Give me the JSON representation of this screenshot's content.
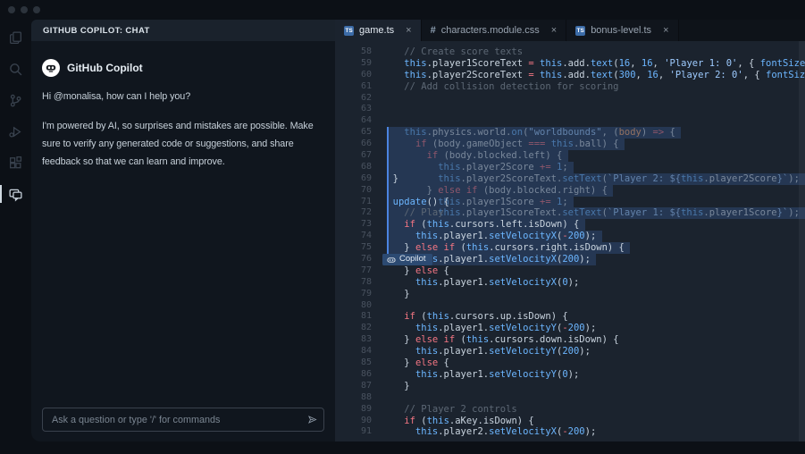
{
  "window": {
    "controls": [
      "close",
      "minimize",
      "maximize"
    ]
  },
  "activity_bar": {
    "items": [
      {
        "name": "explorer"
      },
      {
        "name": "search"
      },
      {
        "name": "source-control"
      },
      {
        "name": "run-and-debug"
      },
      {
        "name": "extensions"
      },
      {
        "name": "copilot-chat",
        "active": true
      }
    ]
  },
  "chat_panel": {
    "header": "GITHUB COPILOT: CHAT",
    "bot_name": "GitHub Copilot",
    "greeting": "Hi @monalisa, how can I help you?",
    "disclaimer": "I'm powered by AI, so surprises and mistakes are possible. Make sure to verify any generated code or suggestions, and share feedback so that we can learn and improve.",
    "input_placeholder": "Ask a question or type '/' for commands",
    "send_icon": "paper-plane"
  },
  "editor": {
    "tabs": [
      {
        "label": "game.ts",
        "icon": "TS",
        "close": "×",
        "active": true
      },
      {
        "label": "characters.module.css",
        "icon": "#",
        "close": "×",
        "active": false
      },
      {
        "label": "bonus-level.ts",
        "icon": "TS",
        "close": "×",
        "active": false
      }
    ],
    "chip_label": "Copilot",
    "lines": [
      {
        "n": 58,
        "t": [
          [
            "c",
            "    // Create score texts"
          ]
        ]
      },
      {
        "n": 59,
        "t": [
          [
            "w",
            "    "
          ],
          [
            "b",
            "this"
          ],
          [
            "w",
            ".player1ScoreText "
          ],
          [
            "k",
            "="
          ],
          [
            "w",
            " "
          ],
          [
            "b",
            "this"
          ],
          [
            "w",
            ".add."
          ],
          [
            "b",
            "text"
          ],
          [
            "w",
            "("
          ],
          [
            "b",
            "16"
          ],
          [
            "w",
            ", "
          ],
          [
            "b",
            "16"
          ],
          [
            "w",
            ", "
          ],
          [
            "s",
            "'Player 1: 0'"
          ],
          [
            "w",
            ", { "
          ],
          [
            "b",
            "fontSize"
          ],
          [
            "w",
            ": "
          ],
          [
            "s",
            "'32px'"
          ],
          [
            "w",
            " });"
          ]
        ]
      },
      {
        "n": 60,
        "t": [
          [
            "w",
            "    "
          ],
          [
            "b",
            "this"
          ],
          [
            "w",
            ".player2ScoreText "
          ],
          [
            "k",
            "="
          ],
          [
            "w",
            " "
          ],
          [
            "b",
            "this"
          ],
          [
            "w",
            ".add."
          ],
          [
            "b",
            "text"
          ],
          [
            "w",
            "("
          ],
          [
            "b",
            "300"
          ],
          [
            "w",
            ", "
          ],
          [
            "b",
            "16"
          ],
          [
            "w",
            ", "
          ],
          [
            "s",
            "'Player 2: 0'"
          ],
          [
            "w",
            ", { "
          ],
          [
            "b",
            "fontSize"
          ],
          [
            "w",
            ": "
          ],
          [
            "s",
            "'32px'"
          ],
          [
            "w",
            " });"
          ]
        ]
      },
      {
        "n": 61,
        "t": [
          [
            "c",
            "    // Add collision detection for scoring"
          ]
        ]
      },
      {
        "n": 62,
        "t": []
      },
      {
        "n": 63,
        "t": []
      },
      {
        "n": 64,
        "t": []
      },
      {
        "n": 65,
        "hl": true,
        "g": true,
        "t": [
          [
            "w",
            "    "
          ],
          [
            "b",
            "this"
          ],
          [
            "w",
            ".physics.world."
          ],
          [
            "b",
            "on"
          ],
          [
            "w",
            "("
          ],
          [
            "s",
            "\"worldbounds\""
          ],
          [
            "w",
            ", ("
          ],
          [
            "o",
            "body"
          ],
          [
            "w",
            ") "
          ],
          [
            "k",
            "=>"
          ],
          [
            "w",
            " {"
          ]
        ]
      },
      {
        "n": 66,
        "hl": true,
        "g": true,
        "t": [
          [
            "w",
            "      "
          ],
          [
            "k",
            "if"
          ],
          [
            "w",
            " (body.gameObject "
          ],
          [
            "k",
            "==="
          ],
          [
            "w",
            " "
          ],
          [
            "b",
            "this"
          ],
          [
            "w",
            ".ball) {"
          ]
        ]
      },
      {
        "n": 67,
        "hl": true,
        "g": true,
        "t": [
          [
            "w",
            "        "
          ],
          [
            "k",
            "if"
          ],
          [
            "w",
            " (body.blocked.left) {"
          ]
        ]
      },
      {
        "n": 68,
        "hl": true,
        "g": true,
        "t": [
          [
            "w",
            "          "
          ],
          [
            "b",
            "this"
          ],
          [
            "w",
            ".player2Score "
          ],
          [
            "k",
            "+="
          ],
          [
            "w",
            " "
          ],
          [
            "b",
            "1"
          ],
          [
            "w",
            ";"
          ]
        ]
      },
      {
        "n": 69,
        "hl": true,
        "g": true,
        "t": [
          [
            "w",
            "          "
          ],
          [
            "b",
            "this"
          ],
          [
            "w",
            ".player2ScoreText."
          ],
          [
            "b",
            "setText"
          ],
          [
            "w",
            "("
          ],
          [
            "s",
            "`Player 2: ${"
          ],
          [
            "b",
            "this"
          ],
          [
            "w",
            ".player2Score"
          ],
          [
            "s",
            "}`"
          ],
          [
            "w",
            ");"
          ]
        ],
        "ov": {
          "c": 2,
          "t": [
            [
              "w",
              "}"
            ]
          ]
        }
      },
      {
        "n": 70,
        "hl": true,
        "g": true,
        "t": [
          [
            "w",
            "        } "
          ],
          [
            "k",
            "else if"
          ],
          [
            "w",
            " (body.blocked.right) {"
          ]
        ]
      },
      {
        "n": 71,
        "hl": true,
        "g": true,
        "t": [
          [
            "w",
            "          "
          ],
          [
            "b",
            "this"
          ],
          [
            "w",
            ".player1Score "
          ],
          [
            "k",
            "+="
          ],
          [
            "w",
            " "
          ],
          [
            "b",
            "1"
          ],
          [
            "w",
            ";"
          ]
        ],
        "ov": {
          "c": 2,
          "t": [
            [
              "b",
              "update"
            ],
            [
              "w",
              "() {"
            ]
          ]
        }
      },
      {
        "n": 72,
        "hl": true,
        "g": true,
        "t": [
          [
            "w",
            "          "
          ],
          [
            "b",
            "this"
          ],
          [
            "w",
            ".player1ScoreText."
          ],
          [
            "b",
            "setText"
          ],
          [
            "w",
            "("
          ],
          [
            "s",
            "`Player 1: ${"
          ],
          [
            "b",
            "this"
          ],
          [
            "w",
            ".player1Score"
          ],
          [
            "s",
            "}`"
          ],
          [
            "w",
            ");"
          ]
        ],
        "ov": {
          "c": 4,
          "t": [
            [
              "c",
              "// Play"
            ]
          ]
        }
      },
      {
        "n": 73,
        "hl": true,
        "t": [
          [
            "w",
            "    "
          ],
          [
            "k",
            "if"
          ],
          [
            "w",
            " ("
          ],
          [
            "b",
            "this"
          ],
          [
            "w",
            ".cursors.left.isDown) {"
          ]
        ]
      },
      {
        "n": 74,
        "hl": true,
        "t": [
          [
            "w",
            "      "
          ],
          [
            "b",
            "this"
          ],
          [
            "w",
            ".player1."
          ],
          [
            "b",
            "setVelocityX"
          ],
          [
            "w",
            "("
          ],
          [
            "k",
            "-"
          ],
          [
            "b",
            "200"
          ],
          [
            "w",
            ");"
          ]
        ]
      },
      {
        "n": 75,
        "hl": true,
        "t": [
          [
            "w",
            "    } "
          ],
          [
            "k",
            "else if"
          ],
          [
            "w",
            " ("
          ],
          [
            "b",
            "this"
          ],
          [
            "w",
            ".cursors.right.isDown) {"
          ]
        ]
      },
      {
        "n": 76,
        "hl": true,
        "chip": true,
        "t": [
          [
            "w",
            "      "
          ],
          [
            "b",
            "this"
          ],
          [
            "w",
            ".player1."
          ],
          [
            "b",
            "setVelocityX"
          ],
          [
            "w",
            "("
          ],
          [
            "b",
            "200"
          ],
          [
            "w",
            ");"
          ]
        ]
      },
      {
        "n": 77,
        "t": [
          [
            "w",
            "    } "
          ],
          [
            "k",
            "else"
          ],
          [
            "w",
            " {"
          ]
        ]
      },
      {
        "n": 78,
        "t": [
          [
            "w",
            "      "
          ],
          [
            "b",
            "this"
          ],
          [
            "w",
            ".player1."
          ],
          [
            "b",
            "setVelocityX"
          ],
          [
            "w",
            "("
          ],
          [
            "b",
            "0"
          ],
          [
            "w",
            ");"
          ]
        ]
      },
      {
        "n": 79,
        "t": [
          [
            "w",
            "    }"
          ]
        ]
      },
      {
        "n": 80,
        "t": []
      },
      {
        "n": 81,
        "t": [
          [
            "w",
            "    "
          ],
          [
            "k",
            "if"
          ],
          [
            "w",
            " ("
          ],
          [
            "b",
            "this"
          ],
          [
            "w",
            ".cursors.up.isDown) {"
          ]
        ]
      },
      {
        "n": 82,
        "t": [
          [
            "w",
            "      "
          ],
          [
            "b",
            "this"
          ],
          [
            "w",
            ".player1."
          ],
          [
            "b",
            "setVelocityY"
          ],
          [
            "w",
            "("
          ],
          [
            "k",
            "-"
          ],
          [
            "b",
            "200"
          ],
          [
            "w",
            ");"
          ]
        ]
      },
      {
        "n": 83,
        "t": [
          [
            "w",
            "    } "
          ],
          [
            "k",
            "else if"
          ],
          [
            "w",
            " ("
          ],
          [
            "b",
            "this"
          ],
          [
            "w",
            ".cursors.down.isDown) {"
          ]
        ]
      },
      {
        "n": 84,
        "t": [
          [
            "w",
            "      "
          ],
          [
            "b",
            "this"
          ],
          [
            "w",
            ".player1."
          ],
          [
            "b",
            "setVelocityY"
          ],
          [
            "w",
            "("
          ],
          [
            "b",
            "200"
          ],
          [
            "w",
            ");"
          ]
        ]
      },
      {
        "n": 85,
        "t": [
          [
            "w",
            "    } "
          ],
          [
            "k",
            "else"
          ],
          [
            "w",
            " {"
          ]
        ]
      },
      {
        "n": 86,
        "t": [
          [
            "w",
            "      "
          ],
          [
            "b",
            "this"
          ],
          [
            "w",
            ".player1."
          ],
          [
            "b",
            "setVelocityY"
          ],
          [
            "w",
            "("
          ],
          [
            "b",
            "0"
          ],
          [
            "w",
            ");"
          ]
        ]
      },
      {
        "n": 87,
        "t": [
          [
            "w",
            "    }"
          ]
        ]
      },
      {
        "n": 88,
        "t": []
      },
      {
        "n": 89,
        "t": [
          [
            "c",
            "    // Player 2 controls"
          ]
        ]
      },
      {
        "n": 90,
        "t": [
          [
            "w",
            "    "
          ],
          [
            "k",
            "if"
          ],
          [
            "w",
            " ("
          ],
          [
            "b",
            "this"
          ],
          [
            "w",
            ".aKey.isDown) {"
          ]
        ]
      },
      {
        "n": 91,
        "t": [
          [
            "w",
            "      "
          ],
          [
            "b",
            "this"
          ],
          [
            "w",
            ".player2."
          ],
          [
            "b",
            "setVelocityX"
          ],
          [
            "w",
            "("
          ],
          [
            "k",
            "-"
          ],
          [
            "b",
            "200"
          ],
          [
            "w",
            ");"
          ]
        ]
      }
    ]
  },
  "colors": {
    "backdrop": "#0c1016",
    "editor_bg": "#1b232e",
    "chat_bg": "#10161e",
    "selection_bg": "rgba(71,126,217,0.22)",
    "selection_border": "#4b84e0",
    "chip_bg": "#2c4a72",
    "ts_icon": "#3c6ca8",
    "keyword": "#f47683",
    "constant": "#6cb6ff",
    "string": "#9ecbff",
    "comment": "#5d6875",
    "param": "#ffab70"
  }
}
